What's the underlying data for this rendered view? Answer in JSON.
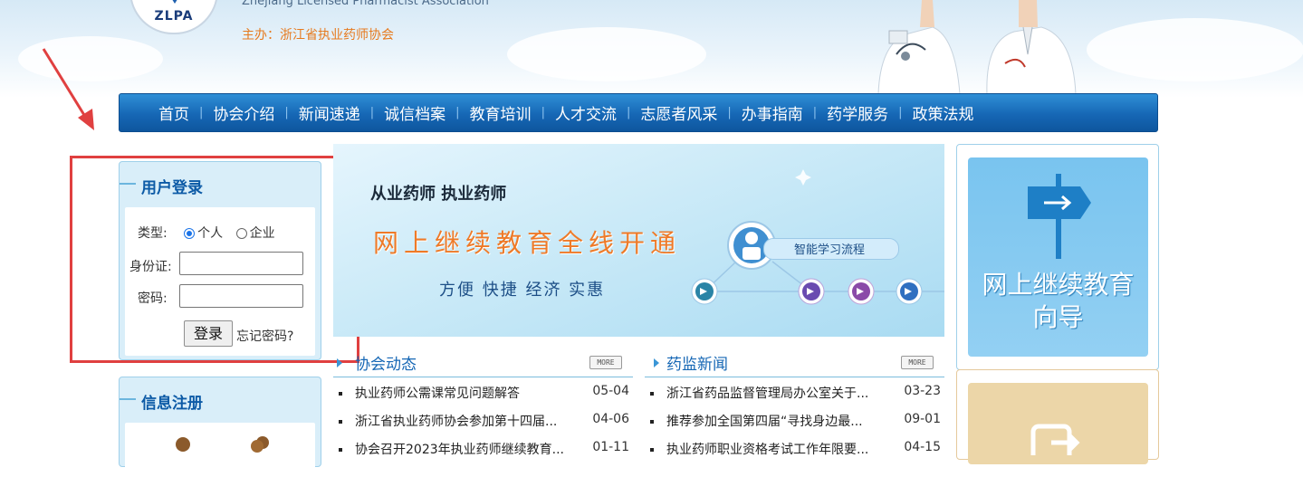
{
  "header": {
    "logo_text": "ZLPA",
    "english_name": "Zhejiang Licensed Pharmacist Association",
    "sponsor": "主办：浙江省执业药师协会"
  },
  "nav": {
    "items": [
      "首页",
      "协会介绍",
      "新闻速递",
      "诚信档案",
      "教育培训",
      "人才交流",
      "志愿者风采",
      "办事指南",
      "药学服务",
      "政策法规"
    ]
  },
  "login": {
    "title": "用户登录",
    "type_label": "类型:",
    "type_options": [
      "个人",
      "企业"
    ],
    "type_selected": "个人",
    "id_label": "身份证:",
    "id_value": "",
    "password_label": "密码:",
    "password_value": "",
    "submit_label": "登录",
    "forgot_label": "忘记密码?"
  },
  "register": {
    "title": "信息注册"
  },
  "banner": {
    "tagline": "从业药师 执业药师",
    "headline": "网上继续教育全线开通",
    "slogan": "方便 快捷 经济 实惠",
    "flow_label": "智能学习流程"
  },
  "association_news": {
    "title": "协会动态",
    "more": "MORE",
    "items": [
      {
        "title": "执业药师公需课常见问题解答",
        "date": "05-04"
      },
      {
        "title": "浙江省执业药师协会参加第十四届...",
        "date": "04-06"
      },
      {
        "title": "协会召开2023年执业药师继续教育...",
        "date": "01-11"
      }
    ]
  },
  "regulator_news": {
    "title": "药监新闻",
    "more": "MORE",
    "items": [
      {
        "title": "浙江省药品监督管理局办公室关于...",
        "date": "03-23"
      },
      {
        "title": "推荐参加全国第四届“寻找身边最...",
        "date": "09-01"
      },
      {
        "title": "执业药师职业资格考试工作年限要...",
        "date": "04-15"
      }
    ]
  },
  "sidebar": {
    "edu_guide": "网上继续教育向导",
    "edu_guide_line1": "网上继续教育",
    "edu_guide_line2": "向导"
  },
  "colors": {
    "nav_blue": "#1667b5",
    "accent_orange": "#ee7a28",
    "highlight_red": "#e04040",
    "panel_bg": "#d9eef9"
  }
}
